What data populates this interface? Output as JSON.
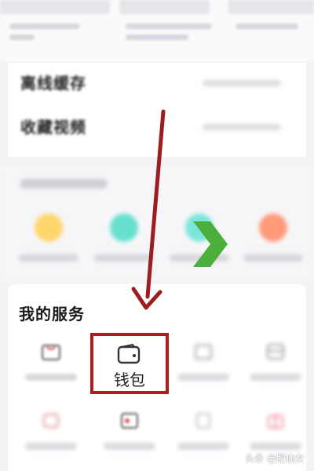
{
  "list": {
    "offline_cache_label": "离线缓存",
    "favorites_video_label": "收藏视频"
  },
  "services": {
    "title": "我的服务",
    "wallet_label": "钱包"
  },
  "watermark": {
    "text": "头条 @肥仙女"
  },
  "colors": {
    "highlight_red": "#b11a1f",
    "arrow_red": "#9b1d20",
    "chevron_green": "#4caf3c"
  }
}
